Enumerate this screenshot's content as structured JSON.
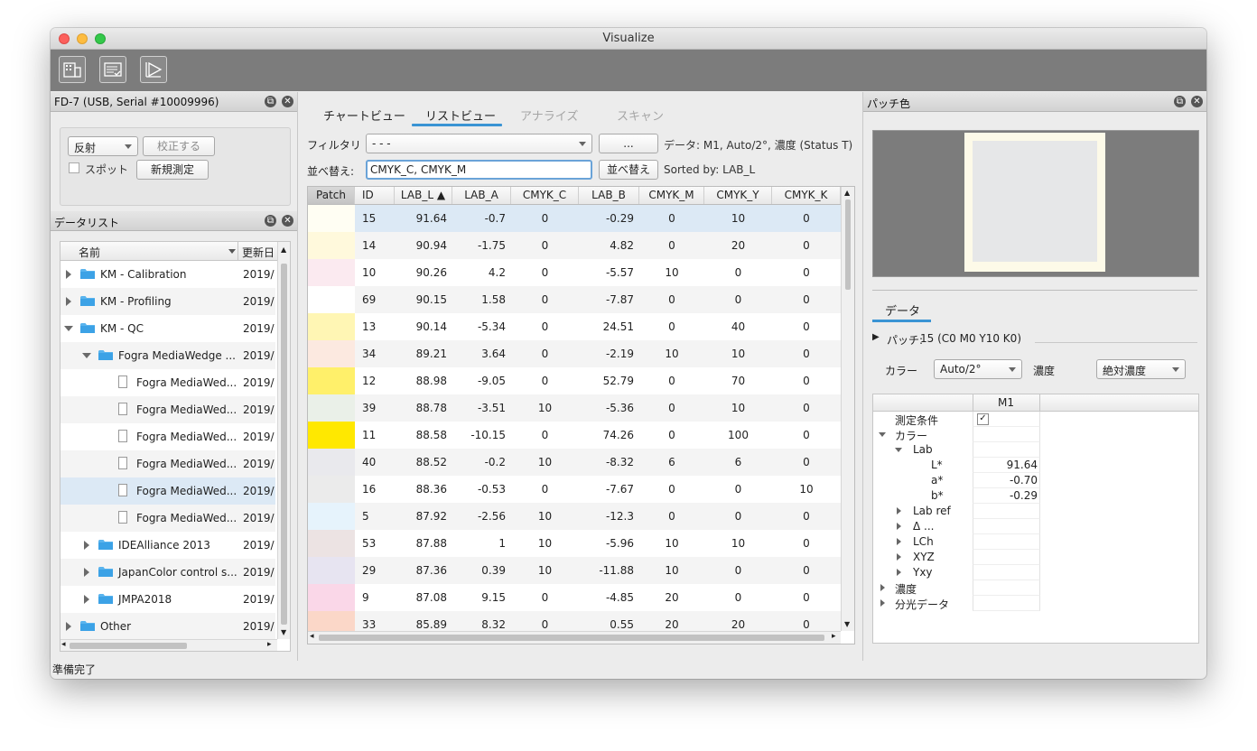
{
  "window": {
    "title": "Visualize"
  },
  "instrument_panel": {
    "title": "FD-7 (USB, Serial #10009996)",
    "mode_select": "反射",
    "calibrate_button": "校正する",
    "spot_checkbox_label": "スポット",
    "new_measure_button": "新規測定"
  },
  "datalist": {
    "title": "データリスト",
    "col_name": "名前",
    "col_date": "更新日",
    "items": [
      {
        "label": "KM - Calibration",
        "date": "2019/",
        "level": 0,
        "type": "folder",
        "expanded": false
      },
      {
        "label": "KM - Profiling",
        "date": "2019/",
        "level": 0,
        "type": "folder",
        "expanded": false
      },
      {
        "label": "KM - QC",
        "date": "2019/",
        "level": 0,
        "type": "folder",
        "expanded": true
      },
      {
        "label": "Fogra MediaWedge ...",
        "date": "2019/",
        "level": 1,
        "type": "folder",
        "expanded": true
      },
      {
        "label": "Fogra MediaWed...",
        "date": "2019/",
        "level": 2,
        "type": "file"
      },
      {
        "label": "Fogra MediaWed...",
        "date": "2019/",
        "level": 2,
        "type": "file"
      },
      {
        "label": "Fogra MediaWed...",
        "date": "2019/",
        "level": 2,
        "type": "file"
      },
      {
        "label": "Fogra MediaWed...",
        "date": "2019/",
        "level": 2,
        "type": "file"
      },
      {
        "label": "Fogra MediaWed...",
        "date": "2019/",
        "level": 2,
        "type": "file",
        "selected": true
      },
      {
        "label": "Fogra MediaWed...",
        "date": "2019/",
        "level": 2,
        "type": "file"
      },
      {
        "label": "IDEAlliance 2013",
        "date": "2019/",
        "level": 1,
        "type": "folder",
        "expanded": false
      },
      {
        "label": "JapanColor control s...",
        "date": "2019/",
        "level": 1,
        "type": "folder",
        "expanded": false
      },
      {
        "label": "JMPA2018",
        "date": "2019/",
        "level": 1,
        "type": "folder",
        "expanded": false
      },
      {
        "label": "Other",
        "date": "2019/",
        "level": 0,
        "type": "folder",
        "expanded": false
      }
    ]
  },
  "status_bar": {
    "text": "準備完了"
  },
  "center": {
    "tabs": [
      {
        "label": "チャートビュー",
        "active": false,
        "disabled": false
      },
      {
        "label": "リストビュー",
        "active": true,
        "disabled": false
      },
      {
        "label": "アナライズ",
        "active": false,
        "disabled": true
      },
      {
        "label": "スキャン",
        "active": false,
        "disabled": true
      }
    ],
    "filter_label": "フィルタリ",
    "filter_value": "- - -",
    "filter_more_button": "...",
    "data_info": "データ: M1, Auto/2°, 濃度 (Status T)",
    "sort_label": "並べ替え:",
    "sort_value": "CMYK_C, CMYK_M",
    "sort_button": "並べ替え",
    "sorted_by": "Sorted by: LAB_L",
    "table": {
      "columns": [
        "Patch",
        "ID",
        "LAB_L ▲",
        "LAB_A",
        "CMYK_C",
        "LAB_B",
        "CMYK_M",
        "CMYK_Y",
        "CMYK_K"
      ],
      "rows": [
        {
          "color": "#fffef3",
          "id": "15",
          "lab_l": "91.64",
          "lab_a": "-0.7",
          "c": "0",
          "lab_b": "-0.29",
          "m": "0",
          "y": "10",
          "k": "0",
          "selected": true
        },
        {
          "color": "#fff9dc",
          "id": "14",
          "lab_l": "90.94",
          "lab_a": "-1.75",
          "c": "0",
          "lab_b": "4.82",
          "m": "0",
          "y": "20",
          "k": "0"
        },
        {
          "color": "#fbeaf0",
          "id": "10",
          "lab_l": "90.26",
          "lab_a": "4.2",
          "c": "0",
          "lab_b": "-5.57",
          "m": "10",
          "y": "0",
          "k": "0"
        },
        {
          "color": "#ffffff",
          "id": "69",
          "lab_l": "90.15",
          "lab_a": "1.58",
          "c": "0",
          "lab_b": "-7.87",
          "m": "0",
          "y": "0",
          "k": "0"
        },
        {
          "color": "#fff6b4",
          "id": "13",
          "lab_l": "90.14",
          "lab_a": "-5.34",
          "c": "0",
          "lab_b": "24.51",
          "m": "0",
          "y": "40",
          "k": "0"
        },
        {
          "color": "#fce9e0",
          "id": "34",
          "lab_l": "89.21",
          "lab_a": "3.64",
          "c": "0",
          "lab_b": "-2.19",
          "m": "10",
          "y": "10",
          "k": "0"
        },
        {
          "color": "#fff06a",
          "id": "12",
          "lab_l": "88.98",
          "lab_a": "-9.05",
          "c": "0",
          "lab_b": "52.79",
          "m": "0",
          "y": "70",
          "k": "0"
        },
        {
          "color": "#eaf0e8",
          "id": "39",
          "lab_l": "88.78",
          "lab_a": "-3.51",
          "c": "10",
          "lab_b": "-5.36",
          "m": "0",
          "y": "10",
          "k": "0"
        },
        {
          "color": "#ffe800",
          "id": "11",
          "lab_l": "88.58",
          "lab_a": "-10.15",
          "c": "0",
          "lab_b": "74.26",
          "m": "0",
          "y": "100",
          "k": "0"
        },
        {
          "color": "#e9e9ed",
          "id": "40",
          "lab_l": "88.52",
          "lab_a": "-0.2",
          "c": "10",
          "lab_b": "-8.32",
          "m": "6",
          "y": "6",
          "k": "0"
        },
        {
          "color": "#ebebeb",
          "id": "16",
          "lab_l": "88.36",
          "lab_a": "-0.53",
          "c": "0",
          "lab_b": "-7.67",
          "m": "0",
          "y": "0",
          "k": "10"
        },
        {
          "color": "#e6f3fc",
          "id": "5",
          "lab_l": "87.92",
          "lab_a": "-2.56",
          "c": "10",
          "lab_b": "-12.3",
          "m": "0",
          "y": "0",
          "k": "0"
        },
        {
          "color": "#ece3e3",
          "id": "53",
          "lab_l": "87.88",
          "lab_a": "1",
          "c": "10",
          "lab_b": "-5.96",
          "m": "10",
          "y": "10",
          "k": "0"
        },
        {
          "color": "#e7e4f1",
          "id": "29",
          "lab_l": "87.36",
          "lab_a": "0.39",
          "c": "10",
          "lab_b": "-11.88",
          "m": "10",
          "y": "0",
          "k": "0"
        },
        {
          "color": "#fad7e8",
          "id": "9",
          "lab_l": "87.08",
          "lab_a": "9.15",
          "c": "0",
          "lab_b": "-4.85",
          "m": "20",
          "y": "0",
          "k": "0"
        },
        {
          "color": "#fbd7c8",
          "id": "33",
          "lab_l": "85.89",
          "lab_a": "8.32",
          "c": "0",
          "lab_b": "0.55",
          "m": "20",
          "y": "20",
          "k": "0"
        }
      ]
    }
  },
  "patch_panel": {
    "title": "パッチ色",
    "preview_outer": "#fdfae8",
    "preview_inner": "#e6e7e8",
    "data_tab": "データ",
    "patch_label": "パッチ:",
    "patch_value": "15 (C0 M0 Y10 K0)",
    "color_label": "カラー",
    "color_value": "Auto/2°",
    "density_label": "濃度",
    "density_value": "絶対濃度",
    "col_header": "M1",
    "props": [
      {
        "label": "測定条件",
        "level": 0,
        "check": true,
        "arrow": ""
      },
      {
        "label": "カラー",
        "level": 0,
        "arrow": "down",
        "value": ""
      },
      {
        "label": "Lab",
        "level": 1,
        "arrow": "down",
        "value": ""
      },
      {
        "label": "L*",
        "level": 2,
        "arrow": "",
        "value": "91.64"
      },
      {
        "label": "a*",
        "level": 2,
        "arrow": "",
        "value": "-0.70"
      },
      {
        "label": "b*",
        "level": 2,
        "arrow": "",
        "value": "-0.29"
      },
      {
        "label": "Lab ref",
        "level": 1,
        "arrow": "right",
        "value": ""
      },
      {
        "label": "Δ ...",
        "level": 1,
        "arrow": "right",
        "value": ""
      },
      {
        "label": "LCh",
        "level": 1,
        "arrow": "right",
        "value": ""
      },
      {
        "label": "XYZ",
        "level": 1,
        "arrow": "right",
        "value": ""
      },
      {
        "label": "Yxy",
        "level": 1,
        "arrow": "right",
        "value": ""
      },
      {
        "label": "濃度",
        "level": 0,
        "arrow": "right",
        "value": ""
      },
      {
        "label": "分光データ",
        "level": 0,
        "arrow": "right",
        "value": ""
      }
    ]
  }
}
